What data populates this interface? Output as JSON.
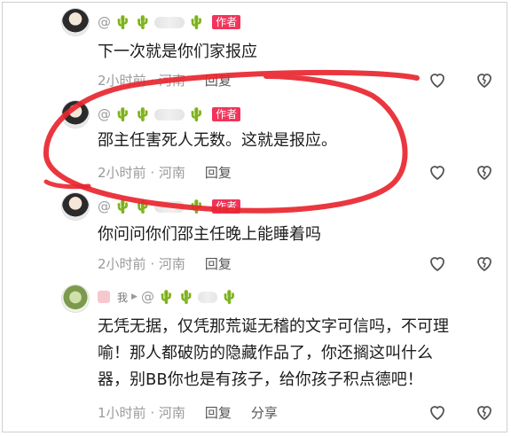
{
  "comments": [
    {
      "author_badge": "作者",
      "text": "下一次就是你们家报应",
      "time": "2小时前",
      "location": "河南",
      "reply_label": "回复"
    },
    {
      "author_badge": "作者",
      "text": "邵主任害死人无数。这就是报应。",
      "time": "2小时前",
      "location": "河南",
      "reply_label": "回复"
    },
    {
      "author_badge": "作者",
      "text": "你问问你们邵主任晚上能睡着吗",
      "time": "2小时前",
      "location": "河南",
      "reply_label": "回复"
    },
    {
      "me_label": "我",
      "text_lines": [
        "无凭无据，仅凭那荒诞无稽的文字可信吗，不可理",
        "喻！那人都破防的隐藏作品了，你还搁这叫什么",
        "器，别BB你也是有孩子，给你孩子积点德吧！"
      ],
      "time": "1小时前",
      "location": "河南",
      "reply_label": "回复",
      "share_label": "分享"
    }
  ],
  "handle_prefix": "@",
  "colors": {
    "author_badge": "#f2345a",
    "annotation": "#e8262f",
    "meta": "#9a9a9a"
  },
  "icons": [
    "heart-icon",
    "dislike-heart-icon",
    "cactus-emoji-icon"
  ]
}
